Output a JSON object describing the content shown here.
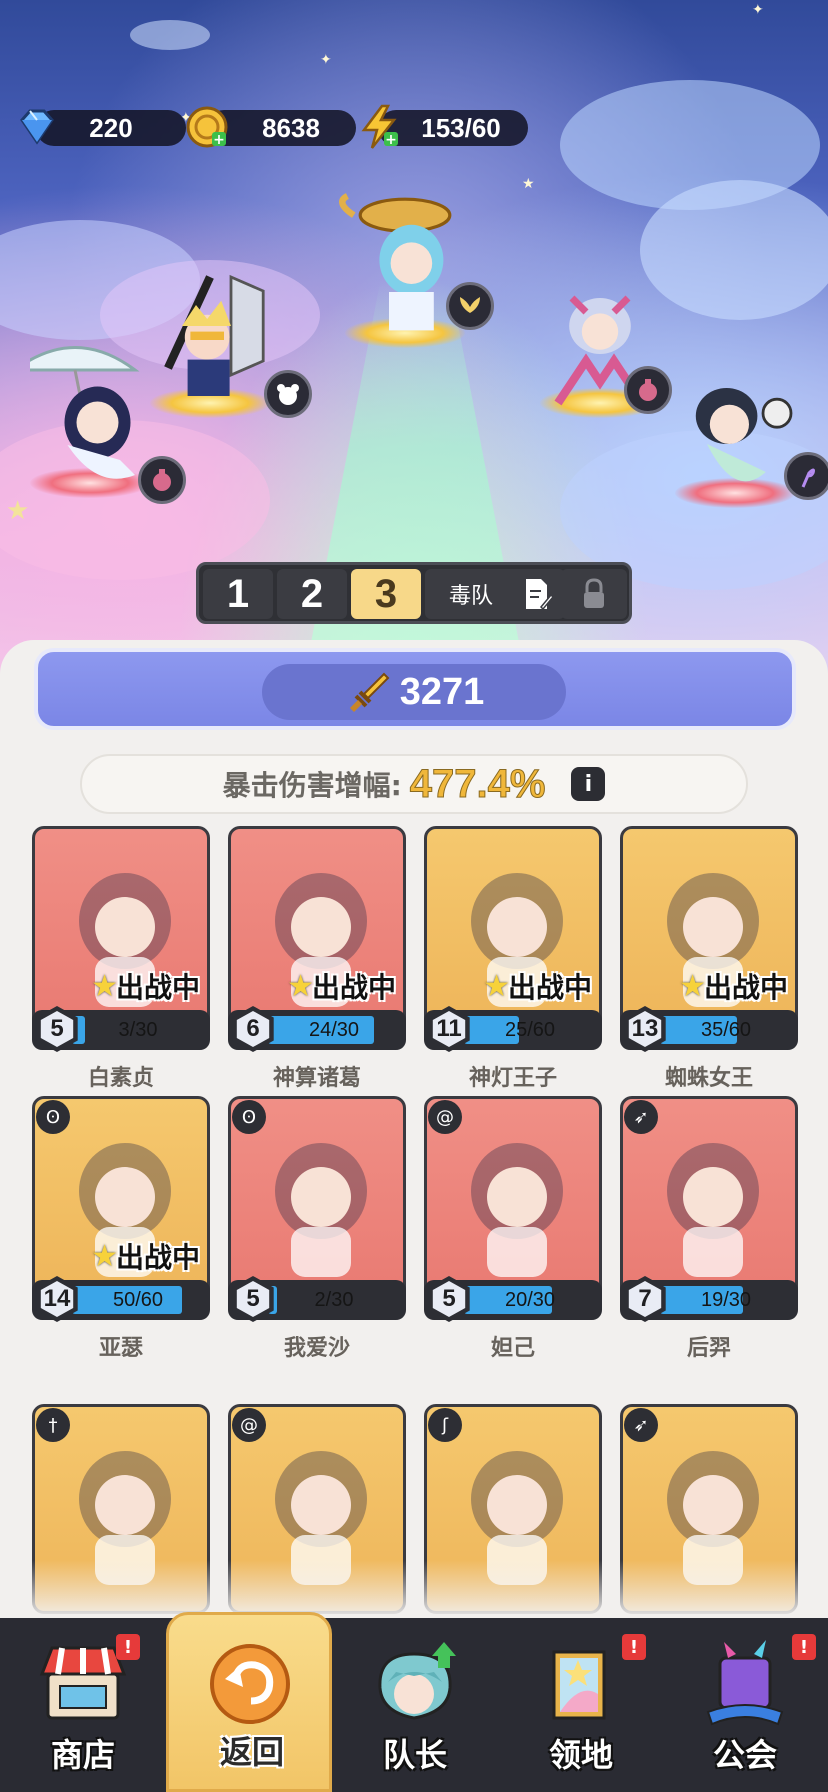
{
  "currencies": [
    {
      "icon": "diamond-icon",
      "value": "220"
    },
    {
      "icon": "gold-coin-icon",
      "value": "8638"
    },
    {
      "icon": "energy-bolt-icon",
      "value": "153/60"
    }
  ],
  "stage_heroes": [
    {
      "name": "白素贞",
      "class_icon": "mage-flask-icon"
    },
    {
      "name": "亚瑟",
      "class_icon": "tank-bear-icon"
    },
    {
      "name": "神灯王子",
      "class_icon": "support-wings-icon"
    },
    {
      "name": "蜘蛛女王",
      "class_icon": "mage-flask-icon"
    },
    {
      "name": "神算诸葛",
      "class_icon": "caster-staff-icon"
    }
  ],
  "team_selector": {
    "tabs": [
      "1",
      "2",
      "3"
    ],
    "active_tab": "3",
    "team_name": "毒队"
  },
  "power": {
    "value": "3271"
  },
  "crit": {
    "label": "暴击伤害增幅:",
    "value": "477.4%",
    "info": "i"
  },
  "deploy_label": "出战中",
  "heroes": [
    {
      "name": "白素贞",
      "level": "5",
      "progress": "3/30",
      "fraction": 0.1,
      "theme": "red",
      "deployed": true,
      "class_icon": ""
    },
    {
      "name": "神算诸葛",
      "level": "6",
      "progress": "24/30",
      "fraction": 0.8,
      "theme": "red",
      "deployed": true,
      "class_icon": ""
    },
    {
      "name": "神灯王子",
      "level": "11",
      "progress": "25/60",
      "fraction": 0.42,
      "theme": "gold",
      "deployed": true,
      "class_icon": ""
    },
    {
      "name": "蜘蛛女王",
      "level": "13",
      "progress": "35/60",
      "fraction": 0.58,
      "theme": "gold",
      "deployed": true,
      "class_icon": ""
    },
    {
      "name": "亚瑟",
      "level": "14",
      "progress": "50/60",
      "fraction": 0.83,
      "theme": "gold",
      "deployed": true,
      "class_icon": "tank-bear-icon"
    },
    {
      "name": "我爱沙",
      "level": "5",
      "progress": "2/30",
      "fraction": 0.07,
      "theme": "red",
      "deployed": false,
      "class_icon": "tank-bear-icon"
    },
    {
      "name": "妲己",
      "level": "5",
      "progress": "20/30",
      "fraction": 0.67,
      "theme": "red",
      "deployed": false,
      "class_icon": "swirl-icon"
    },
    {
      "name": "后羿",
      "level": "7",
      "progress": "19/30",
      "fraction": 0.63,
      "theme": "red",
      "deployed": false,
      "class_icon": "bow-icon"
    },
    {
      "name": "",
      "level": "",
      "progress": "",
      "fraction": 0,
      "theme": "gold",
      "deployed": false,
      "class_icon": "sword-icon"
    },
    {
      "name": "",
      "level": "",
      "progress": "",
      "fraction": 0,
      "theme": "gold",
      "deployed": false,
      "class_icon": "swirl-icon"
    },
    {
      "name": "",
      "level": "",
      "progress": "",
      "fraction": 0,
      "theme": "gold",
      "deployed": false,
      "class_icon": "caster-staff-icon"
    },
    {
      "name": "",
      "level": "",
      "progress": "",
      "fraction": 0,
      "theme": "gold",
      "deployed": false,
      "class_icon": "bow-icon"
    }
  ],
  "nav": [
    {
      "label": "商店",
      "icon": "shop-icon",
      "notice": "!",
      "active": false
    },
    {
      "label": "返回",
      "icon": "return-icon",
      "notice": "",
      "active": true
    },
    {
      "label": "队长",
      "icon": "captain-icon",
      "notice": "",
      "active": false
    },
    {
      "label": "领地",
      "icon": "territory-icon",
      "notice": "!",
      "active": false
    },
    {
      "label": "公会",
      "icon": "guild-icon",
      "notice": "!",
      "active": false
    }
  ],
  "colors": {
    "accent_gold": "#f0b73a",
    "progress_blue": "#3aa5e8",
    "power_purple": "#7b86e6",
    "notice_red": "#e63a3a"
  }
}
